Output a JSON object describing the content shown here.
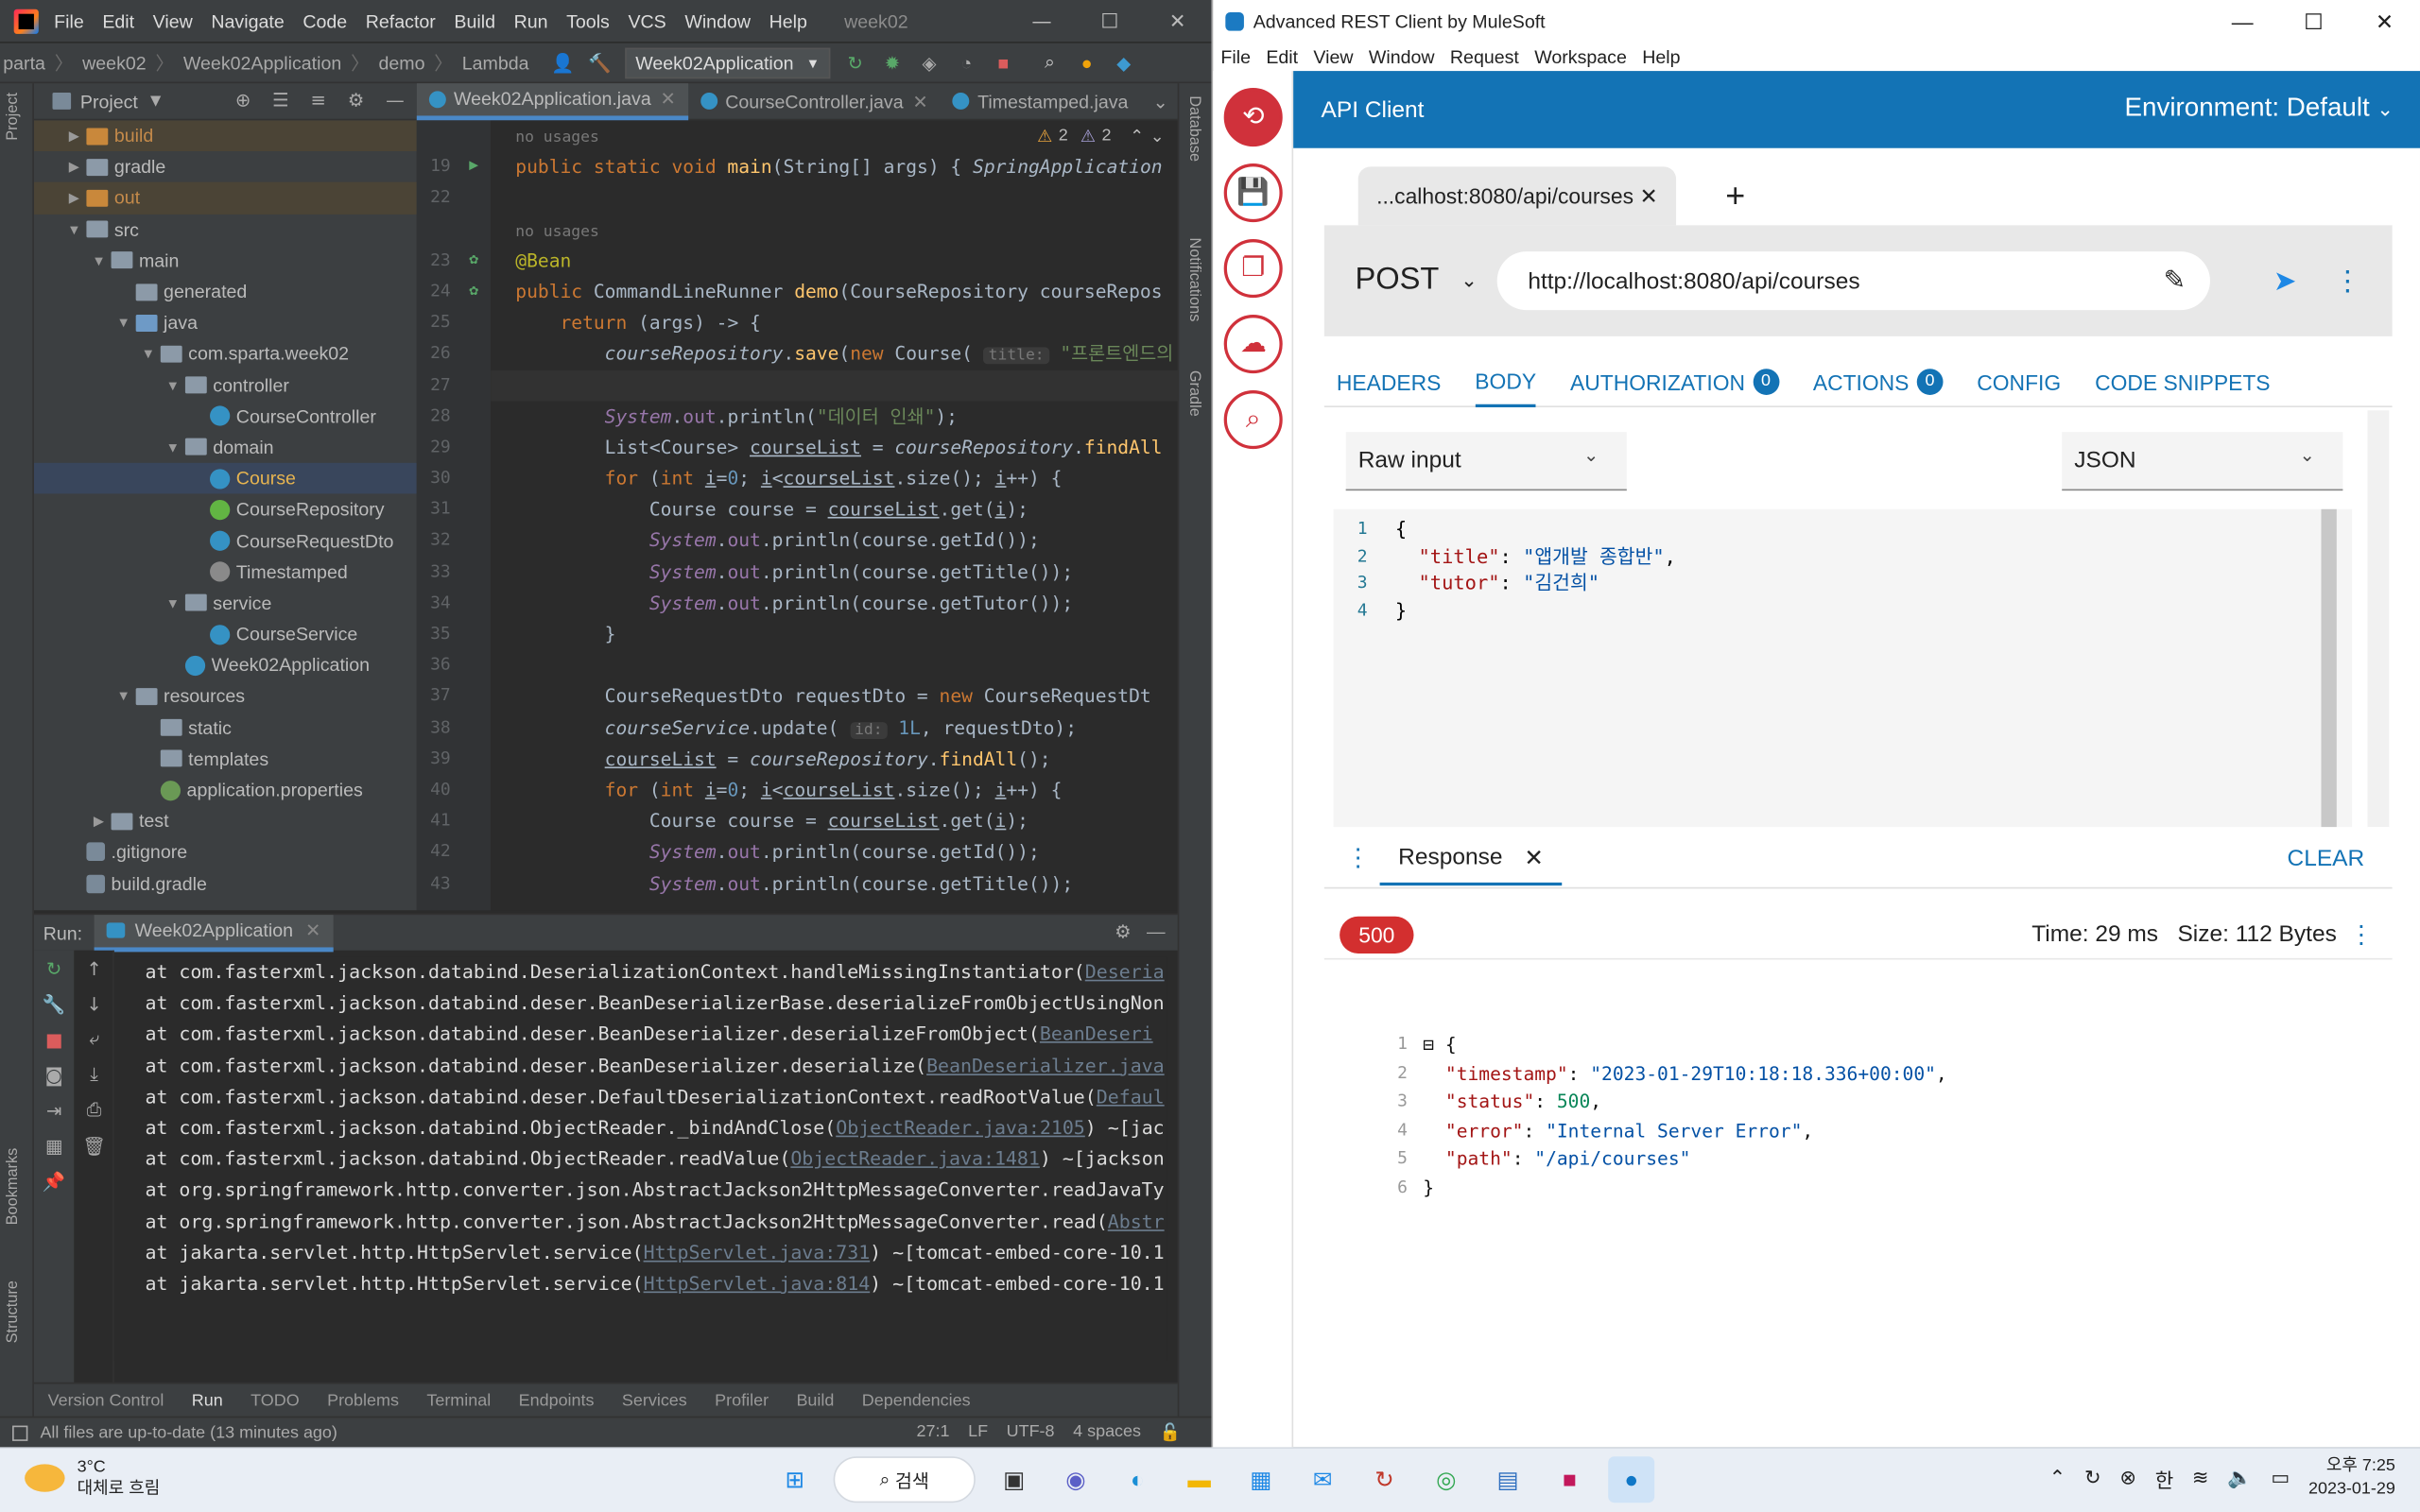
{
  "ide": {
    "menu": [
      "File",
      "Edit",
      "View",
      "Navigate",
      "Code",
      "Refactor",
      "Build",
      "Run",
      "Tools",
      "VCS",
      "Window",
      "Help"
    ],
    "window_title": "week02",
    "breadcrumbs": [
      "parta",
      "week02",
      "Week02Application",
      "demo",
      "Lambda"
    ],
    "run_config": "Week02Application",
    "project_panel_title": "Project",
    "tree": [
      {
        "label": "build",
        "depth": 1,
        "type": "folder-excluded"
      },
      {
        "label": "gradle",
        "depth": 1,
        "type": "folder"
      },
      {
        "label": "out",
        "depth": 1,
        "type": "folder-excluded"
      },
      {
        "label": "src",
        "depth": 1,
        "type": "folder",
        "open": true
      },
      {
        "label": "main",
        "depth": 2,
        "type": "folder",
        "open": true
      },
      {
        "label": "generated",
        "depth": 3,
        "type": "folder"
      },
      {
        "label": "java",
        "depth": 3,
        "type": "folder-src",
        "open": true
      },
      {
        "label": "com.sparta.week02",
        "depth": 4,
        "type": "package",
        "open": true
      },
      {
        "label": "controller",
        "depth": 5,
        "type": "package",
        "open": true
      },
      {
        "label": "CourseController",
        "depth": 6,
        "type": "class"
      },
      {
        "label": "domain",
        "depth": 5,
        "type": "package",
        "open": true
      },
      {
        "label": "Course",
        "depth": 6,
        "type": "class",
        "selected": true
      },
      {
        "label": "CourseRepository",
        "depth": 6,
        "type": "interface"
      },
      {
        "label": "CourseRequestDto",
        "depth": 6,
        "type": "class"
      },
      {
        "label": "Timestamped",
        "depth": 6,
        "type": "abstract"
      },
      {
        "label": "service",
        "depth": 5,
        "type": "package",
        "open": true
      },
      {
        "label": "CourseService",
        "depth": 6,
        "type": "class"
      },
      {
        "label": "Week02Application",
        "depth": 5,
        "type": "class"
      },
      {
        "label": "resources",
        "depth": 3,
        "type": "folder",
        "open": true
      },
      {
        "label": "static",
        "depth": 4,
        "type": "folder"
      },
      {
        "label": "templates",
        "depth": 4,
        "type": "folder"
      },
      {
        "label": "application.properties",
        "depth": 4,
        "type": "properties"
      },
      {
        "label": "test",
        "depth": 2,
        "type": "folder",
        "closed": true
      },
      {
        "label": ".gitignore",
        "depth": 1,
        "type": "file"
      },
      {
        "label": "build.gradle",
        "depth": 1,
        "type": "gradle"
      }
    ],
    "editor_tabs": [
      "Week02Application.java",
      "CourseController.java",
      "Timestamped.java"
    ],
    "inspections": {
      "warnings": "2",
      "weak": "2"
    },
    "code": [
      {
        "n": "",
        "html": "<span class='gray'>no usages</span>"
      },
      {
        "n": "19",
        "html": "<span class='kw'>public static void </span><span class='fn'>main</span>(<span class='ty'>String</span>[] <span class='pa'>args</span>) { <span class='it'>SpringApplication</span>"
      },
      {
        "n": "22",
        "html": ""
      },
      {
        "n": "",
        "html": "<span class='gray'>no usages</span>"
      },
      {
        "n": "23",
        "html": "<span class='an'>@Bean</span>"
      },
      {
        "n": "24",
        "html": "<span class='kw'>public </span><span class='ty'>CommandLineRunner </span><span class='fn'>demo</span>(<span class='ty'>CourseRepository </span><span class='pa'>courseRepos</span>"
      },
      {
        "n": "25",
        "html": "    <span class='kw'>return </span>(<span class='pa'>args</span>) -&gt; {"
      },
      {
        "n": "26",
        "html": "        <span class='pa it'>courseRepository</span>.<span class='fn'>save</span>(<span class='kw'>new </span>Course( <span class='hint'>title:</span> <span class='st'>\"프론트엔드의</span>"
      },
      {
        "n": "27",
        "html": "",
        "hl": true
      },
      {
        "n": "28",
        "html": "        <span class='fl it'>System</span>.<span class='fl'>out</span>.println(<span class='st'>\"데이터 인쇄\"</span>);"
      },
      {
        "n": "29",
        "html": "        List&lt;Course&gt; <span class='ul'>courseList</span> = <span class='pa it'>courseRepository</span>.<span class='fn'>findAll</span>"
      },
      {
        "n": "30",
        "html": "        <span class='kw'>for </span>(<span class='kw'>int </span><span class='ul'>i</span>=<span class='nu'>0</span>; <span class='ul'>i</span>&lt;<span class='ul'>courseList</span>.size(); <span class='ul'>i</span>++) {"
      },
      {
        "n": "31",
        "html": "            Course course = <span class='ul'>courseList</span>.get(<span class='ul'>i</span>);"
      },
      {
        "n": "32",
        "html": "            <span class='fl it'>System</span>.<span class='fl'>out</span>.println(course.getId());"
      },
      {
        "n": "33",
        "html": "            <span class='fl it'>System</span>.<span class='fl'>out</span>.println(course.getTitle());"
      },
      {
        "n": "34",
        "html": "            <span class='fl it'>System</span>.<span class='fl'>out</span>.println(course.getTutor());"
      },
      {
        "n": "35",
        "html": "        }"
      },
      {
        "n": "36",
        "html": ""
      },
      {
        "n": "37",
        "html": "        CourseRequestDto requestDto = <span class='kw'>new </span>CourseRequestDt"
      },
      {
        "n": "38",
        "html": "        <span class='pa it'>courseService</span>.update( <span class='hint'>id:</span> <span class='nu'>1L</span>, requestDto);"
      },
      {
        "n": "39",
        "html": "        <span class='ul'>courseList</span> = <span class='pa it'>courseRepository</span>.<span class='fn'>findAll</span>();"
      },
      {
        "n": "40",
        "html": "        <span class='kw'>for </span>(<span class='kw'>int </span><span class='ul'>i</span>=<span class='nu'>0</span>; <span class='ul'>i</span>&lt;<span class='ul'>courseList</span>.size(); <span class='ul'>i</span>++) {"
      },
      {
        "n": "41",
        "html": "            Course course = <span class='ul'>courseList</span>.get(<span class='ul'>i</span>);"
      },
      {
        "n": "42",
        "html": "            <span class='fl it'>System</span>.<span class='fl'>out</span>.println(course.getId());"
      },
      {
        "n": "43",
        "html": "            <span class='fl it'>System</span>.<span class='fl'>out</span>.println(course.getTitle());"
      }
    ],
    "run_label": "Run:",
    "run_tab": "Week02Application",
    "console": [
      {
        "t": "at com.fasterxml.jackson.databind.DeserializationContext.handleMissingInstantiator(",
        "l": "Deseria"
      },
      {
        "t": "at com.fasterxml.jackson.databind.deser.BeanDeserializerBase.deserializeFromObjectUsingNon",
        "l": ""
      },
      {
        "t": "at com.fasterxml.jackson.databind.deser.BeanDeserializer.deserializeFromObject(",
        "l": "BeanDeseri"
      },
      {
        "t": "at com.fasterxml.jackson.databind.deser.BeanDeserializer.deserialize(",
        "l": "BeanDeserializer.java"
      },
      {
        "t": "at com.fasterxml.jackson.databind.deser.DefaultDeserializationContext.readRootValue(",
        "l": "Defaul"
      },
      {
        "t": "at com.fasterxml.jackson.databind.ObjectReader._bindAndClose(",
        "l": "ObjectReader.java:2105",
        "a": ") ~[jac"
      },
      {
        "t": "at com.fasterxml.jackson.databind.ObjectReader.readValue(",
        "l": "ObjectReader.java:1481",
        "a": ") ~[jackson"
      },
      {
        "t": "at org.springframework.http.converter.json.AbstractJackson2HttpMessageConverter.readJavaTy",
        "l": ""
      },
      {
        "t": "at org.springframework.http.converter.json.AbstractJackson2HttpMessageConverter.read(",
        "l": "Abstr"
      },
      {
        "t": "at jakarta.servlet.http.HttpServlet.service(",
        "l": "HttpServlet.java:731",
        "a": ") ~[tomcat-embed-core-10.1"
      },
      {
        "t": "at jakarta.servlet.http.HttpServlet.service(",
        "l": "HttpServlet.java:814",
        "a": ") ~[tomcat-embed-core-10.1"
      }
    ],
    "bottom_tabs": [
      "Version Control",
      "Run",
      "TODO",
      "Problems",
      "Terminal",
      "Endpoints",
      "Services",
      "Profiler",
      "Build",
      "Dependencies"
    ],
    "status_msg": "All files are up-to-date (13 minutes ago)",
    "status_right": [
      "27:1",
      "LF",
      "UTF-8",
      "4 spaces"
    ],
    "side_labels": {
      "left": [
        "Project",
        "Bookmarks",
        "Structure"
      ],
      "right": [
        "Database",
        "Notifications",
        "Gradle"
      ]
    }
  },
  "arc": {
    "window_title": "Advanced REST Client by MuleSoft",
    "menu": [
      "File",
      "Edit",
      "View",
      "Window",
      "Request",
      "Workspace",
      "Help"
    ],
    "header_title": "API Client",
    "environment": "Environment: Default",
    "request_tab": "...calhost:8080/api/courses",
    "method": "POST",
    "url": "http://localhost:8080/api/courses",
    "tabs": [
      {
        "label": "HEADERS"
      },
      {
        "label": "BODY",
        "active": true
      },
      {
        "label": "AUTHORIZATION",
        "badge": "0"
      },
      {
        "label": "ACTIONS",
        "badge": "0"
      },
      {
        "label": "CONFIG"
      },
      {
        "label": "CODE SNIPPETS"
      }
    ],
    "body_editor_type": "Raw input",
    "content_type": "JSON",
    "body_lines": [
      {
        "n": "1",
        "html": "{"
      },
      {
        "n": "2",
        "html": "  <span class='ekey'>\"title\"</span>: <span class='estr'>\"앱개발 종합반\"</span>,"
      },
      {
        "n": "3",
        "html": "  <span class='ekey'>\"tutor\"</span>: <span class='estr'>\"김건희\"</span>"
      },
      {
        "n": "4",
        "html": "}"
      }
    ],
    "response_tab": "Response",
    "clear_label": "CLEAR",
    "status_code": "500",
    "time": "Time: 29 ms",
    "size": "Size: 112 Bytes",
    "response_lines": [
      {
        "n": "1",
        "html": "{"
      },
      {
        "n": "2",
        "html": "  <span class='rkey'>\"timestamp\"</span>: <span class='rstr'>\"2023-01-29T10:18:18.336+00:00\"</span>,"
      },
      {
        "n": "3",
        "html": "  <span class='rkey'>\"status\"</span>: <span class='rnumv'>500</span>,"
      },
      {
        "n": "4",
        "html": "  <span class='rkey'>\"error\"</span>: <span class='rstr'>\"Internal Server Error\"</span>,"
      },
      {
        "n": "5",
        "html": "  <span class='rkey'>\"path\"</span>: <span class='rstr'>\"/api/courses\"</span>"
      },
      {
        "n": "6",
        "html": "}"
      }
    ]
  },
  "taskbar": {
    "weather_temp": "3°C",
    "weather_desc": "대체로 흐림",
    "search": "검색",
    "ime": "한",
    "time": "오후 7:25",
    "date": "2023-01-29"
  },
  "colors": {
    "accent": "#1373b5",
    "error": "#d32f2f",
    "ide_bg": "#2b2b2b"
  }
}
